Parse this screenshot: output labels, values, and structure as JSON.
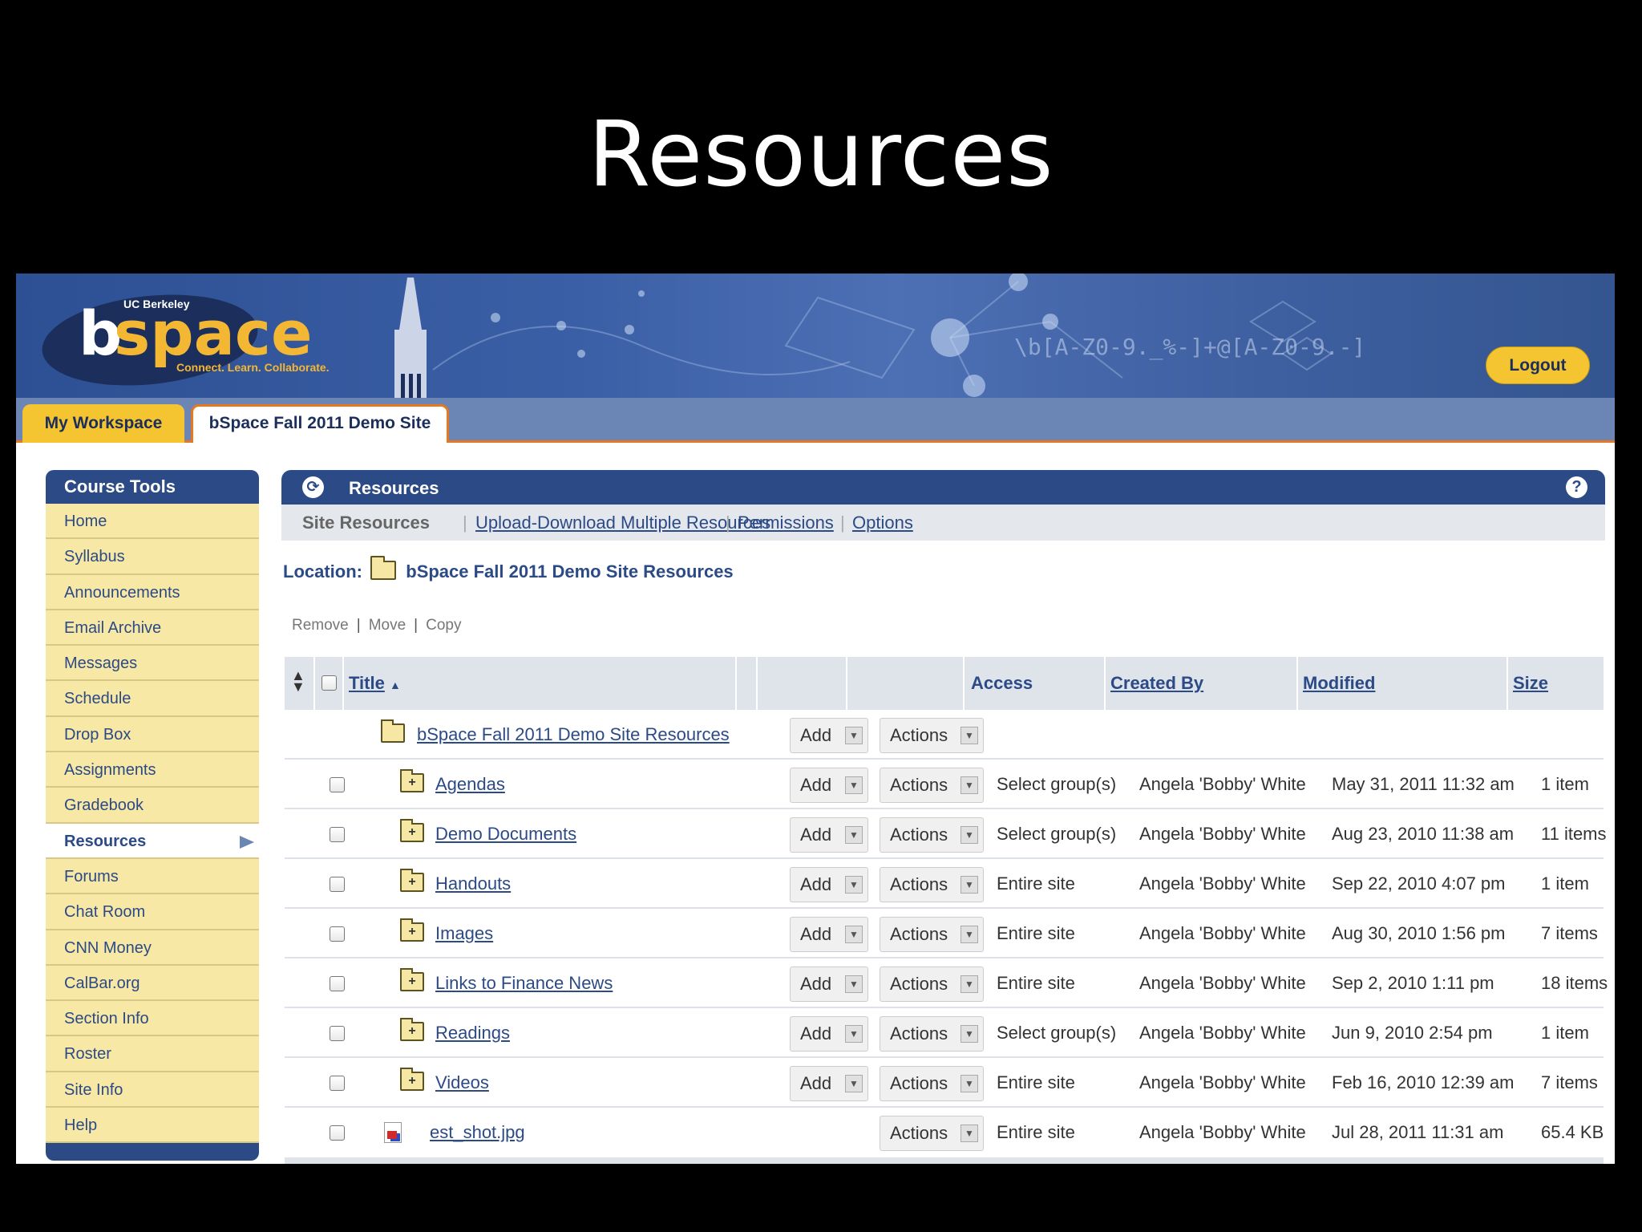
{
  "slide": {
    "title": "Resources"
  },
  "header": {
    "logo_top": "UC Berkeley",
    "logo_b": "b",
    "logo_space": "space",
    "logo_tagline": "Connect. Learn. Collaborate.",
    "logout": "Logout"
  },
  "site_tabs": [
    {
      "label": "My Workspace"
    },
    {
      "label": "bSpace Fall 2011 Demo Site"
    }
  ],
  "nav": {
    "title": "Course Tools",
    "items": [
      "Home",
      "Syllabus",
      "Announcements",
      "Email Archive",
      "Messages",
      "Schedule",
      "Drop Box",
      "Assignments",
      "Gradebook",
      "Resources",
      "Forums",
      "Chat Room",
      "CNN Money",
      "CalBar.org",
      "Section Info",
      "Roster",
      "Site Info",
      "Help"
    ],
    "active": "Resources"
  },
  "tool": {
    "title": "Resources",
    "help_glyph": "?",
    "menu": {
      "current": "Site Resources",
      "links": [
        "Upload-Download Multiple Resources",
        "Permissions",
        "Options"
      ]
    },
    "location_label": "Location:",
    "location_value": "bSpace Fall 2011 Demo Site Resources",
    "bulk": [
      "Remove",
      "Move",
      "Copy"
    ]
  },
  "table": {
    "columns": {
      "title": "Title",
      "access": "Access",
      "created_by": "Created By",
      "modified": "Modified",
      "size": "Size"
    },
    "title_sort_glyph": "▲",
    "add_label": "Add",
    "actions_label": "Actions",
    "root": {
      "title": "bSpace Fall 2011 Demo Site Resources"
    },
    "rows": [
      {
        "title": "Agendas",
        "access": "Select group(s)",
        "created_by": "Angela 'Bobby' White",
        "modified": "May 31, 2011 11:32 am",
        "size": "1 item"
      },
      {
        "title": "Demo Documents",
        "access": "Select group(s)",
        "created_by": "Angela 'Bobby' White",
        "modified": "Aug 23, 2010 11:38 am",
        "size": "11 items"
      },
      {
        "title": "Handouts",
        "access": "Entire site",
        "created_by": "Angela 'Bobby' White",
        "modified": "Sep 22, 2010 4:07 pm",
        "size": "1 item"
      },
      {
        "title": "Images",
        "access": "Entire site",
        "created_by": "Angela 'Bobby' White",
        "modified": "Aug 30, 2010 1:56 pm",
        "size": "7 items"
      },
      {
        "title": "Links to Finance News",
        "access": "Entire site",
        "created_by": "Angela 'Bobby' White",
        "modified": "Sep 2, 2010 1:11 pm",
        "size": "18 items"
      },
      {
        "title": "Readings",
        "access": "Select group(s)",
        "created_by": "Angela 'Bobby' White",
        "modified": "Jun 9, 2010 2:54 pm",
        "size": "1 item"
      },
      {
        "title": "Videos",
        "access": "Entire site",
        "created_by": "Angela 'Bobby' White",
        "modified": "Feb 16, 2010 12:39 am",
        "size": "7 items"
      }
    ],
    "file_row": {
      "title": "est_shot.jpg",
      "access": "Entire site",
      "created_by": "Angela 'Bobby' White",
      "modified": "Jul 28, 2011 11:31 am",
      "size": "65.4 KB"
    }
  }
}
